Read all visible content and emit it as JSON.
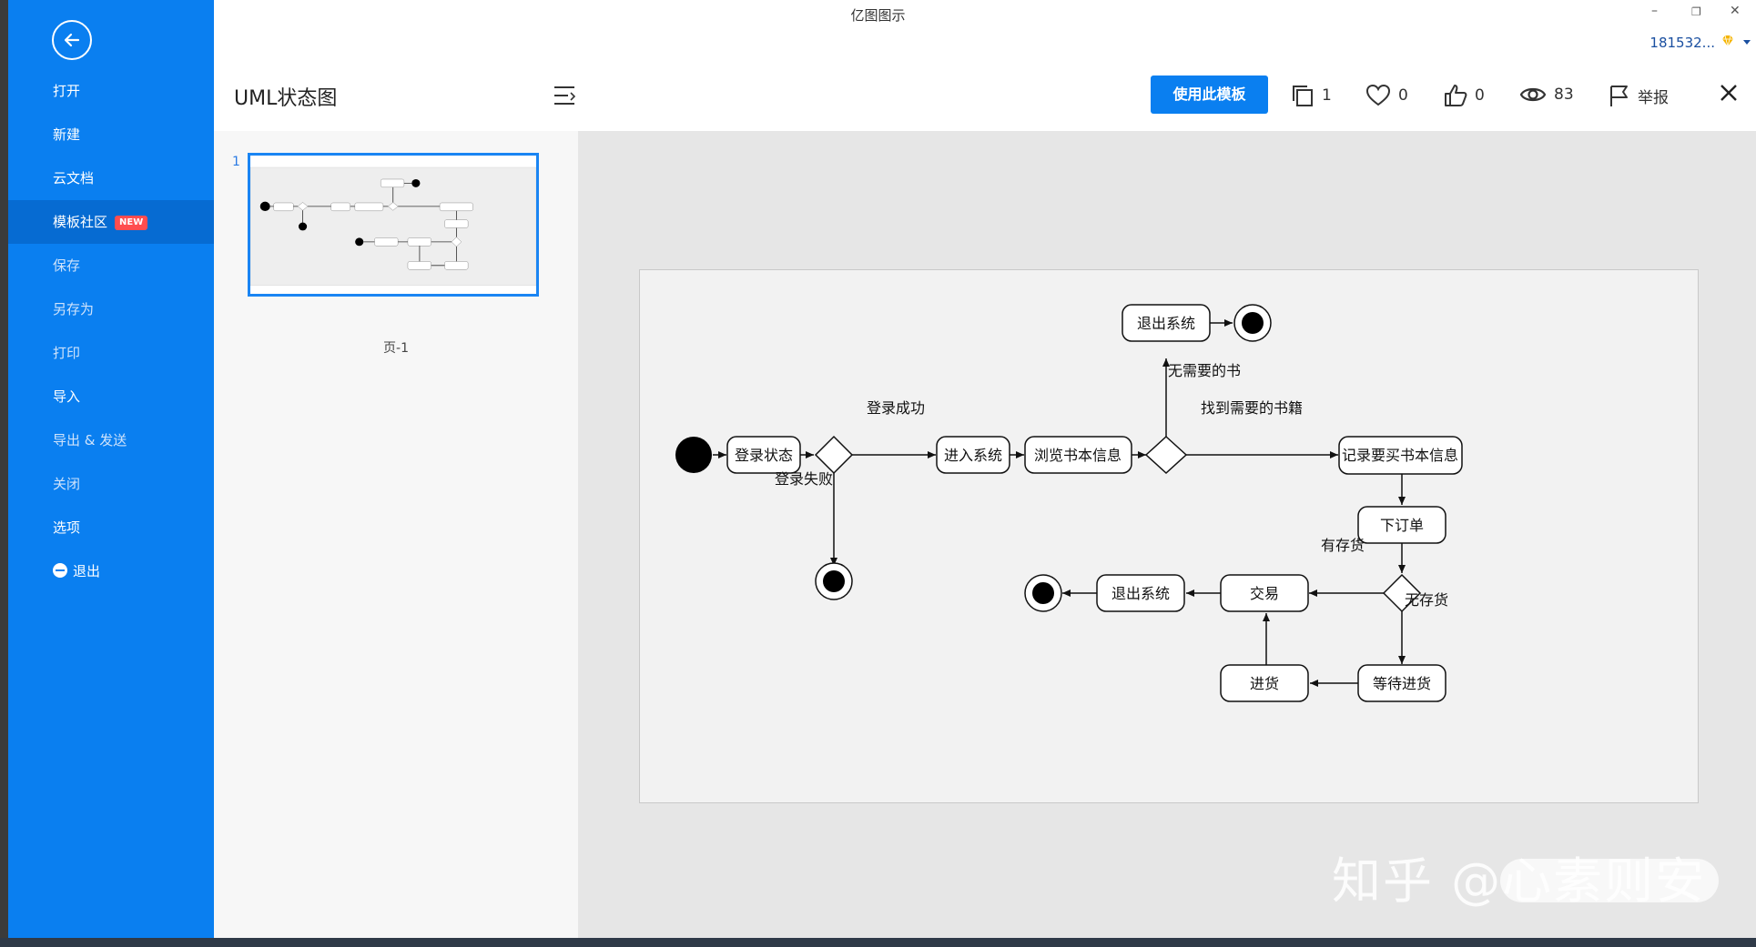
{
  "window": {
    "app_title": "亿图图示",
    "minimize": "–",
    "restore": "❐",
    "close": "✕",
    "user": "181532..."
  },
  "sidebar": {
    "items": [
      {
        "label": "打开"
      },
      {
        "label": "新建"
      },
      {
        "label": "云文档"
      },
      {
        "label": "模板社区",
        "badge": "NEW"
      },
      {
        "label": "保存"
      },
      {
        "label": "另存为"
      },
      {
        "label": "打印"
      },
      {
        "label": "导入"
      },
      {
        "label": "导出 & 发送"
      },
      {
        "label": "关闭"
      },
      {
        "label": "选项"
      },
      {
        "label": "退出"
      }
    ]
  },
  "toolbar": {
    "doc_title": "UML状态图",
    "use_template": "使用此模板",
    "copies": "1",
    "likes_heart": "0",
    "thumbs_up": "0",
    "views": "83",
    "report": "举报"
  },
  "pages": {
    "number": "1",
    "label": "页-1"
  },
  "diagram": {
    "states": {
      "login_state": "登录状态",
      "enter_system": "进入系统",
      "browse_books": "浏览书本信息",
      "record_books": "记录要买书本信息",
      "exit_system_top": "退出系统",
      "place_order": "下订单",
      "trade": "交易",
      "exit_system_bottom": "退出系统",
      "stock_in": "进货",
      "wait_stock": "等待进货"
    },
    "transitions": {
      "login_success": "登录成功",
      "login_failed": "登录失败",
      "no_needed_book": "无需要的书",
      "found_book": "找到需要的书籍",
      "in_stock": "有存货",
      "out_of_stock": "无存货"
    }
  },
  "watermark": "知乎 @心素则安",
  "colors": {
    "sidebar": "#0a7ff0",
    "accent": "#0a7ff0",
    "badge": "#ff4d4f"
  }
}
